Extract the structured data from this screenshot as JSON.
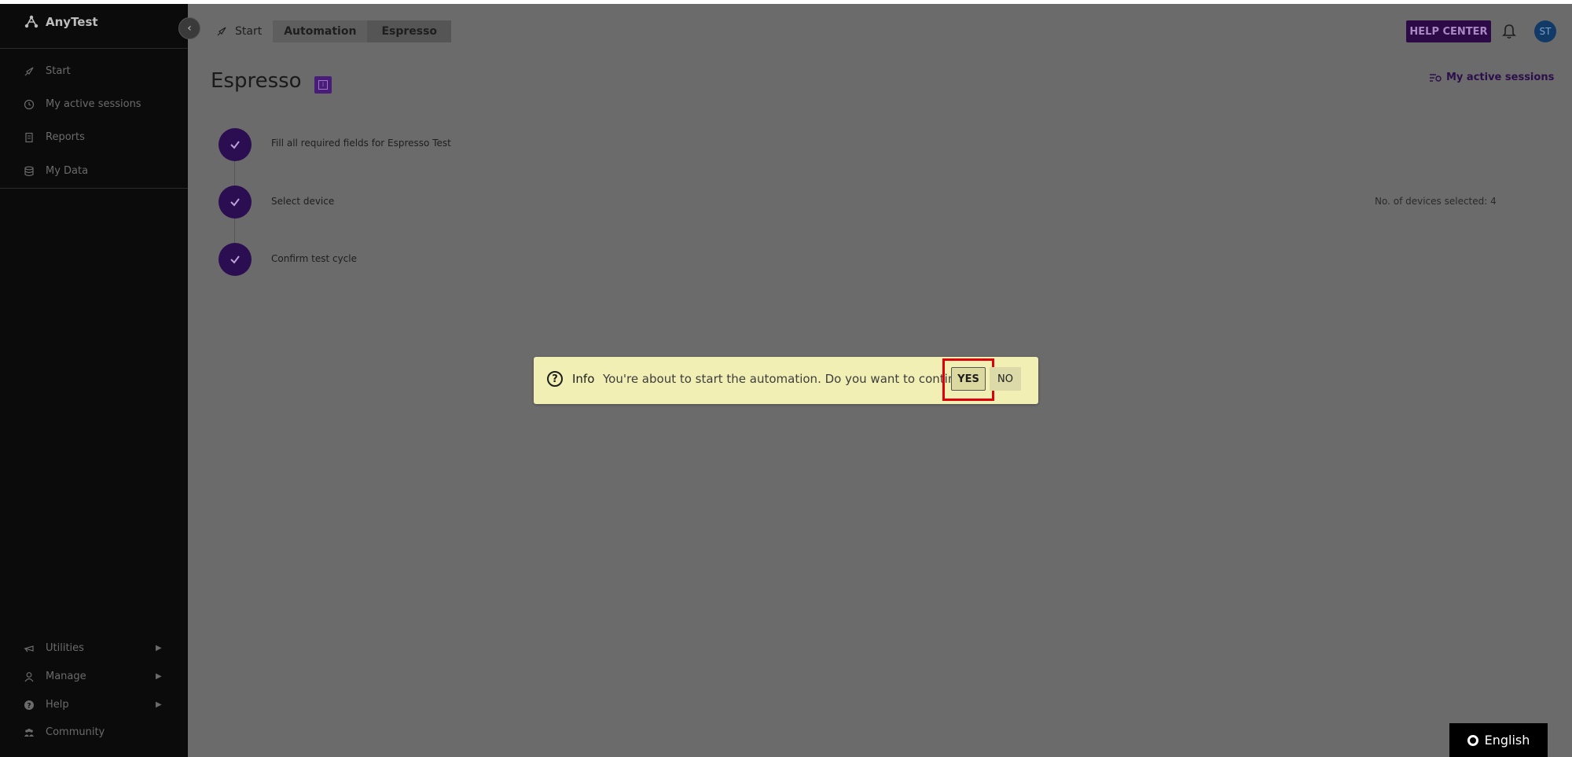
{
  "app": {
    "name": "AnyTest"
  },
  "sidebar": {
    "items": [
      {
        "label": "Start",
        "icon": "rocket-icon"
      },
      {
        "label": "My active sessions",
        "icon": "clock-icon"
      },
      {
        "label": "Reports",
        "icon": "report-icon"
      },
      {
        "label": "My Data",
        "icon": "database-icon"
      }
    ],
    "bottom_items": [
      {
        "label": "Utilities",
        "icon": "utilities-icon"
      },
      {
        "label": "Manage",
        "icon": "person-icon"
      },
      {
        "label": "Help",
        "icon": "help-icon"
      },
      {
        "label": "Community",
        "icon": "community-icon"
      }
    ]
  },
  "breadcrumb": {
    "start": "Start",
    "automation": "Automation",
    "espresso": "Espresso"
  },
  "header": {
    "help_center": "HELP CENTER",
    "avatar_initials": "ST"
  },
  "page": {
    "title": "Espresso",
    "sessions_link": "My active sessions",
    "steps": [
      {
        "label": "Fill all required fields for Espresso Test",
        "status": "done"
      },
      {
        "label": "Select device",
        "status": "done"
      },
      {
        "label": "Confirm test cycle",
        "status": "done"
      }
    ],
    "devices_selected": "No. of devices selected: 4"
  },
  "dialog": {
    "title": "Info",
    "message": "You're about to start the automation. Do you want to continue?",
    "yes_label": "YES",
    "no_label": "NO"
  },
  "language": {
    "label": "English"
  },
  "colors": {
    "accent": "#2b0e52",
    "dialog_bg": "#f1efb4",
    "highlight": "#e0000c",
    "overlay": "#6b6b6b"
  }
}
